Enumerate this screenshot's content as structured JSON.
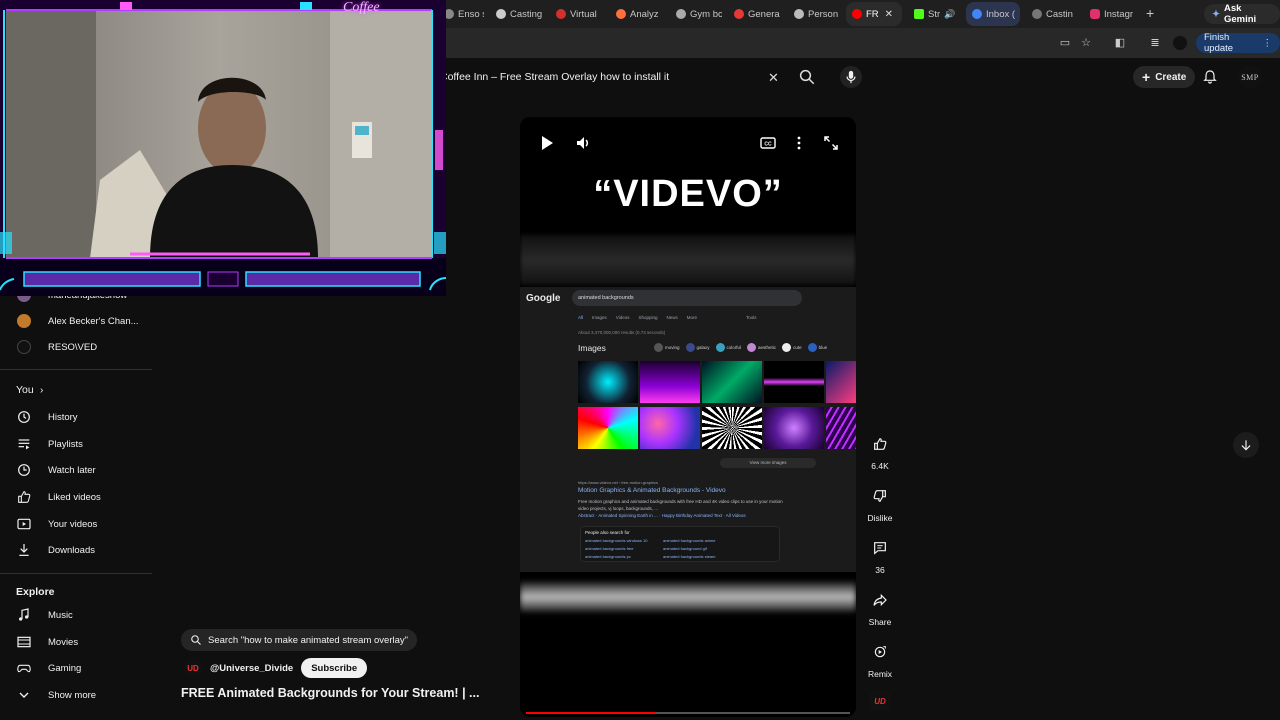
{
  "browser": {
    "tabs": [
      {
        "label": "Enso st",
        "color": "#888888"
      },
      {
        "label": "Casting",
        "color": "#cccccc"
      },
      {
        "label": "Virtual",
        "color": "#d32f2f"
      },
      {
        "label": "Analyz",
        "color": "#ff6f3c"
      },
      {
        "label": "Gym bc",
        "color": "#aaaaaa"
      },
      {
        "label": "Genera",
        "color": "#e53935"
      },
      {
        "label": "Person",
        "color": "#bbbbbb"
      },
      {
        "label": "FR",
        "color": "#ff0000"
      },
      {
        "label": "Str",
        "color": "#53fc18"
      },
      {
        "label": "Inbox (",
        "color": "#4285f4"
      },
      {
        "label": "Castin",
        "color": "#777777"
      },
      {
        "label": "Instagr",
        "color": "#e1306c"
      }
    ],
    "ask_gemini": "Ask Gemini",
    "finish_update": "Finish update"
  },
  "header": {
    "search_query": "Coffee Inn – Free Stream Overlay how to install it",
    "create_label": "Create",
    "avatar_text": "SMP"
  },
  "webcam": {
    "label": "Coffee"
  },
  "sidebar": {
    "channels": [
      {
        "label": "marieandjakeshow",
        "color": "#7a5c8a"
      },
      {
        "label": "Alex Becker's Chan...",
        "color": "#c07a2a"
      },
      {
        "label": "RESO\\VED",
        "color": "#111111"
      }
    ],
    "you_label": "You",
    "you_items": [
      {
        "label": "History",
        "icon": "history-icon"
      },
      {
        "label": "Playlists",
        "icon": "playlists-icon"
      },
      {
        "label": "Watch later",
        "icon": "watch-later-icon"
      },
      {
        "label": "Liked videos",
        "icon": "like-icon"
      },
      {
        "label": "Your videos",
        "icon": "your-videos-icon"
      },
      {
        "label": "Downloads",
        "icon": "download-icon"
      }
    ],
    "explore_label": "Explore",
    "explore_items": [
      {
        "label": "Music",
        "icon": "music-icon"
      },
      {
        "label": "Movies",
        "icon": "movies-icon"
      },
      {
        "label": "Gaming",
        "icon": "gaming-icon"
      },
      {
        "label": "Show more",
        "icon": "chevron-down-icon"
      }
    ]
  },
  "player": {
    "video_title": "“VIDEVO”",
    "progress": 0.4,
    "google": {
      "logo": "Google",
      "query": "animated backgrounds",
      "tabs": [
        "All",
        "Images",
        "Videos",
        "Shopping",
        "News",
        "More",
        "Tools"
      ],
      "stats": "About 3,470,000,000 results (0.73 seconds)",
      "images_heading": "Images",
      "chips": [
        "moving",
        "galaxy",
        "colorful",
        "aesthetic",
        "cute",
        "blue"
      ],
      "view_more": "View more images",
      "result_url": "https://www.videvo.net › free-motion-graphics",
      "result_title": "Motion Graphics & Animated Backgrounds - Videvo",
      "result_snippet": "Free motion graphics and animated backgrounds with free HD and 4K video clips to use in your motion video projects, vj loops, backgrounds, ...",
      "result_links": "Abstract · Animated Spinning Earth in ... · Happy Birthday Animated Text · All Videos",
      "pasf_heading": "People also search for",
      "pasf": [
        "animated backgrounds windows 10",
        "animated backgrounds anime",
        "animated backgrounds free",
        "animated background gif",
        "animated backgrounds pc",
        "animated backgrounds steam"
      ]
    }
  },
  "overlay": {
    "search_suggestion": "Search \"how to make animated stream overlay\"",
    "channel_handle": "@Universe_Divide",
    "channel_avatar": "UD",
    "subscribe_label": "Subscribe",
    "short_title": "FREE Animated Backgrounds for Your Stream! | ..."
  },
  "actions": {
    "like_count": "6.4K",
    "dislike_label": "Dislike",
    "comments_count": "36",
    "share_label": "Share",
    "remix_label": "Remix"
  },
  "colors": {
    "accent_red": "#ff0000",
    "neon_purple": "#b23cff",
    "neon_cyan": "#29e2ff"
  }
}
